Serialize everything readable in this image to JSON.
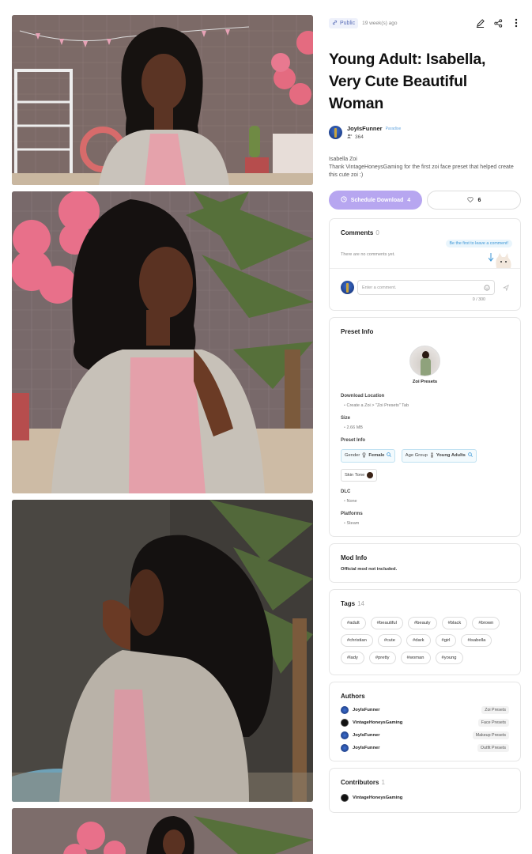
{
  "meta": {
    "visibility": "Public",
    "time_ago": "19 week(s) ago"
  },
  "title": "Young Adult: Isabella, Very Cute Beautiful Woman",
  "author": {
    "name": "JoyIsFunner",
    "badge": "Paradise",
    "followers": "364"
  },
  "description": [
    "Isabella Zoi",
    "Thank VintageHoneysGaming for the first zoi face preset that helped create this cute zoi :)"
  ],
  "actions": {
    "download_label": "Schedule Download",
    "download_count": "4",
    "likes": "6"
  },
  "comments": {
    "title": "Comments",
    "count": "0",
    "empty_text": "There are no comments yet.",
    "bubble": "Be the first to leave a comment!",
    "placeholder": "Enter a comment.",
    "char_count": "0 / 300"
  },
  "preset_info": {
    "title": "Preset Info",
    "preset_type": "Zoi Presets",
    "download_location_label": "Download Location",
    "download_location": "Create a Zoi > \"Zoi Presets\" Tab",
    "size_label": "Size",
    "size": "2.66 MB",
    "info_label": "Preset Info",
    "gender_label": "Gender",
    "gender": "Female",
    "age_label": "Age Group",
    "age": "Young Adults",
    "skin_label": "Skin Tone",
    "skin_color": "#3a2216",
    "dlc_label": "DLC",
    "dlc": "None",
    "platforms_label": "Platforms",
    "platform": "Steam"
  },
  "mod_info": {
    "title": "Mod Info",
    "text": "Official mod not included."
  },
  "tags": {
    "title": "Tags",
    "count": "14",
    "items": [
      "#adult",
      "#beautiful",
      "#beauty",
      "#black",
      "#brown",
      "#christian",
      "#cute",
      "#dark",
      "#girl",
      "#isabella",
      "#lady",
      "#pretty",
      "#woman",
      "#young"
    ]
  },
  "authors": {
    "title": "Authors",
    "items": [
      {
        "name": "JoyIsFunner",
        "role": "Zoi Presets"
      },
      {
        "name": "VintageHoneysGaming",
        "role": "Face Presets"
      },
      {
        "name": "JoyIsFunner",
        "role": "Makeup Presets"
      },
      {
        "name": "JoyIsFunner",
        "role": "Outfit Presets"
      }
    ]
  },
  "contributors": {
    "title": "Contributors",
    "count": "1",
    "items": [
      {
        "name": "VintageHoneysGaming"
      }
    ]
  },
  "colors": {
    "accent": "#b7a6f0",
    "link": "#5b6fb8",
    "tag_border": "#bfe1f1"
  }
}
